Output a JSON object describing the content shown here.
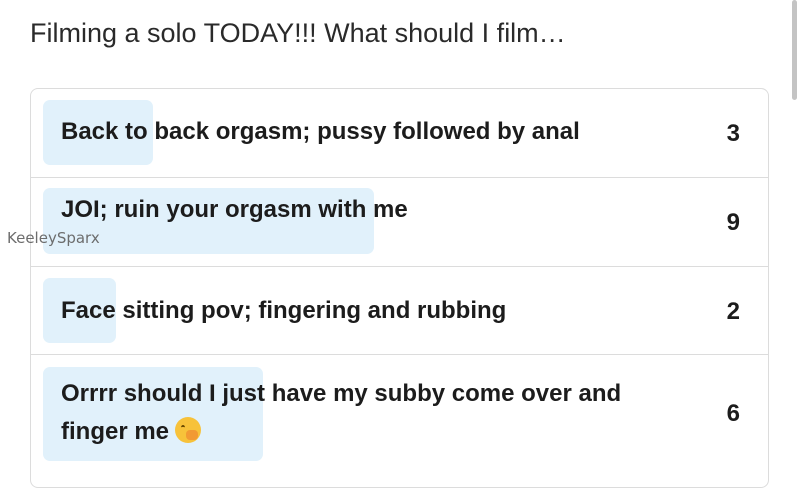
{
  "poll": {
    "question": "Filming a solo TODAY!!! What should I film…",
    "options": [
      {
        "label": "Back to back orgasm; pussy followed by anal",
        "votes": "3",
        "share": 0.15
      },
      {
        "label": "JOI; ruin your orgasm with me",
        "votes": "9",
        "share": 0.45
      },
      {
        "label": "Face sitting pov; fingering and rubbing",
        "votes": "2",
        "share": 0.1
      },
      {
        "label": "Orrrr should I just have my subby come over and finger me",
        "votes": "6",
        "share": 0.3,
        "emoji": "face-with-hand-over-mouth"
      }
    ]
  },
  "watermark": "KeeleySparx",
  "colors": {
    "bar_fill": "#e1f1fb",
    "border": "#dcdcdc"
  }
}
